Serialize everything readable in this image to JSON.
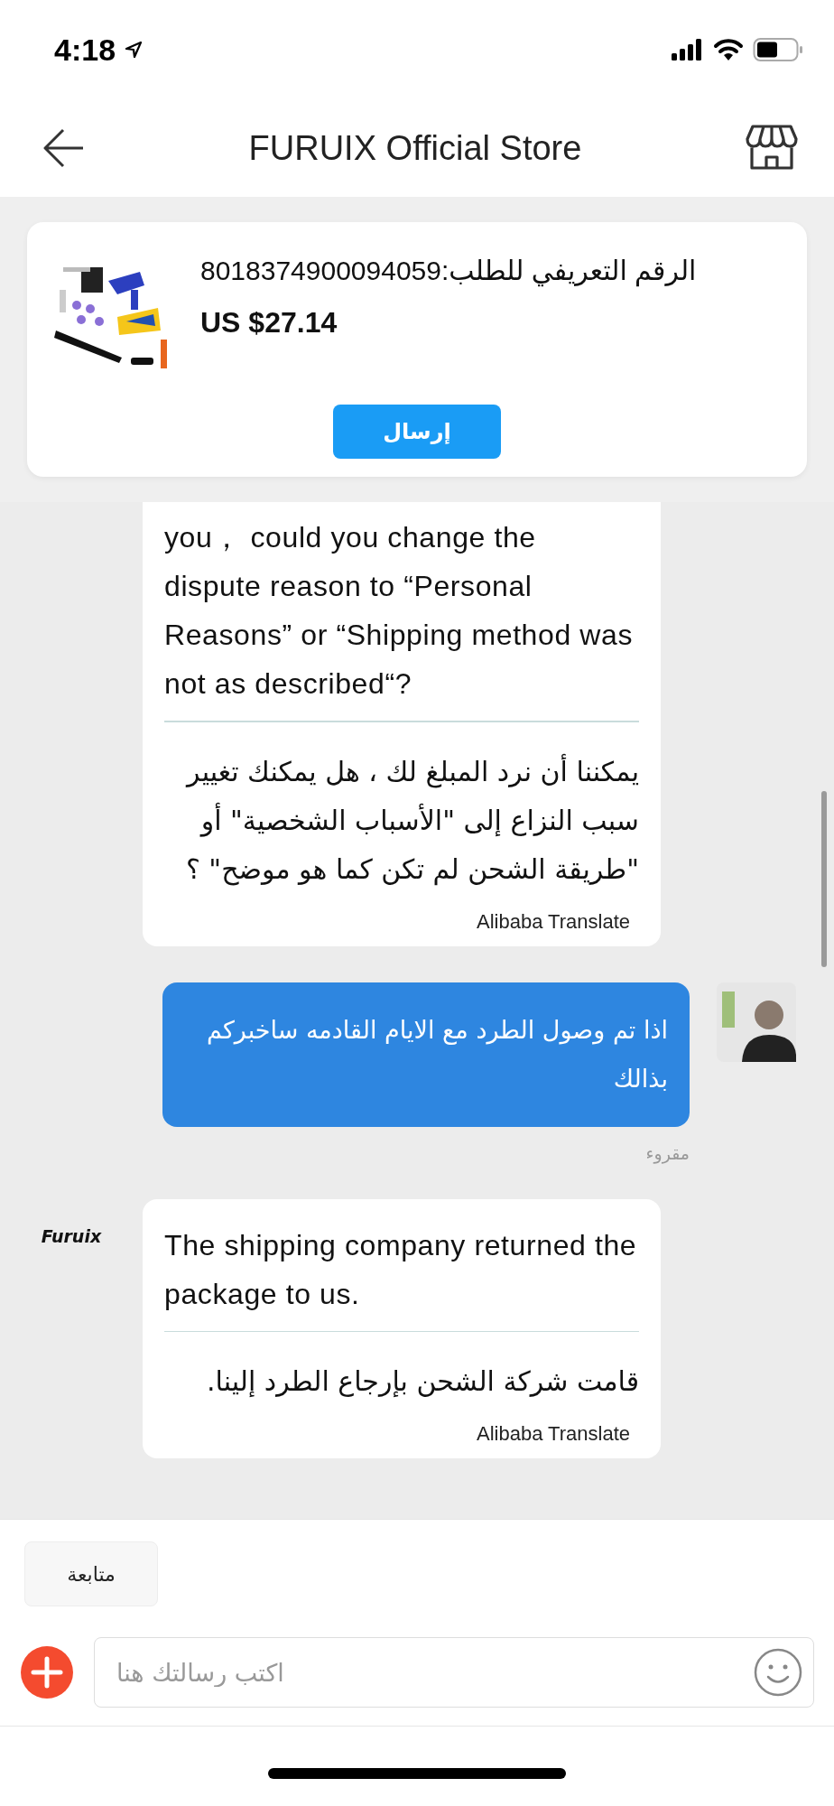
{
  "status_bar": {
    "time": "4:18"
  },
  "header": {
    "title": "FURUIX Official Store"
  },
  "order_card": {
    "order_label": "الرقم التعريفي للطلب:8018374900094059",
    "price": "US $27.14",
    "send_button": "إرسال"
  },
  "messages": [
    {
      "kind": "received",
      "text": "you，  could you change the dispute reason to “Personal Reasons” or “Shipping method was not as described“?",
      "translation": "يمكننا أن نرد المبلغ لك ، هل يمكنك تغيير سبب النزاع إلى \"الأسباب الشخصية\" أو \"طريقة الشحن لم تكن كما هو موضح\" ؟",
      "translation_credit": "Alibaba Translate"
    },
    {
      "kind": "sent",
      "text": "اذا تم وصول الطرد مع الايام القادمه ساخبركم بذالك",
      "status": "مقروء"
    },
    {
      "kind": "received",
      "sender_logo": "Furuix",
      "text": "The shipping company returned the package to us.",
      "translation": "قامت شركة الشحن بإرجاع الطرد إلينا.",
      "translation_credit": "Alibaba Translate"
    }
  ],
  "follow_button": "متابعة",
  "composer": {
    "placeholder": "اكتب رسالتك هنا"
  }
}
